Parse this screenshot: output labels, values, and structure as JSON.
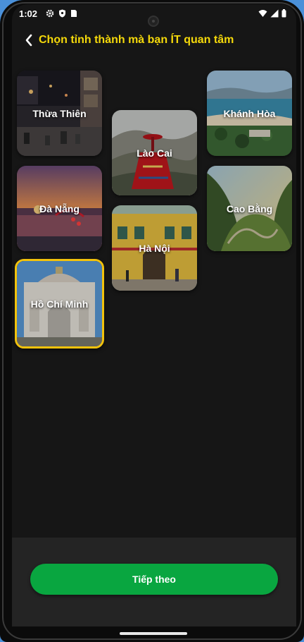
{
  "status_bar": {
    "time": "1:02"
  },
  "header": {
    "title": "Chọn tỉnh thành mà bạn ÍT quan tâm"
  },
  "cards": [
    {
      "label": "Thừa Thiên",
      "selected": false
    },
    {
      "label": "Lào Cai",
      "selected": false
    },
    {
      "label": "Khánh Hòa",
      "selected": false
    },
    {
      "label": "Đà Nẵng",
      "selected": false
    },
    {
      "label": "Cao Bằng",
      "selected": false
    },
    {
      "label": "Hà Nội",
      "selected": false
    },
    {
      "label": "Hồ Chí Minh",
      "selected": true
    }
  ],
  "footer": {
    "next_label": "Tiếp theo"
  },
  "colors": {
    "accent_yellow": "#f5d90a",
    "selected_border": "#f2c20c",
    "button_green": "#09a640",
    "background": "#161616"
  }
}
